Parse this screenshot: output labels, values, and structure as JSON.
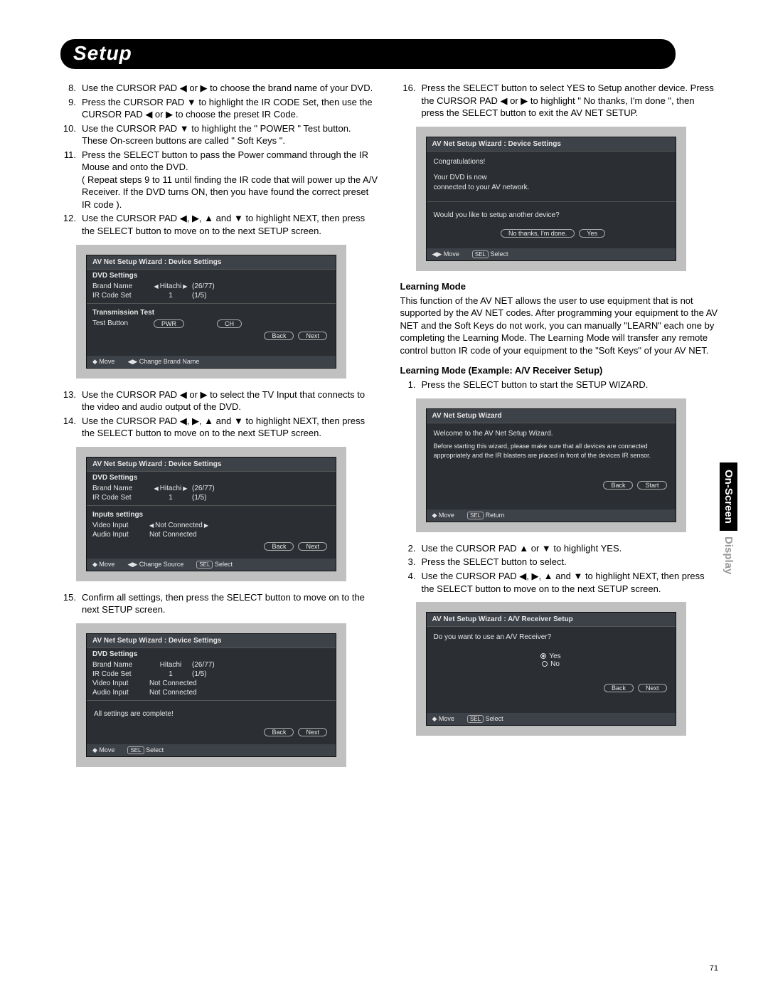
{
  "chapter": "Setup",
  "sideTab": {
    "black": "On-Screen",
    "gray": "Display"
  },
  "pageNumber": "71",
  "left": {
    "steps": [
      {
        "n": "8.",
        "t": "Use the CURSOR PAD ◀ or ▶ to choose the brand name of your DVD."
      },
      {
        "n": "9.",
        "t": "Press the CURSOR PAD ▼ to highlight the IR CODE Set, then use the CURSOR PAD ◀ or ▶ to choose the preset IR Code."
      },
      {
        "n": "10.",
        "t": "Use the CURSOR PAD ▼ to highlight the \" POWER \" Test button.\nThese On-screen buttons are called \" Soft Keys \"."
      },
      {
        "n": "11.",
        "t": "Press the SELECT button to pass the Power command through the IR Mouse and onto the DVD.\n( Repeat steps 9 to 11 until finding the IR code that will power up the A/V Receiver. If the DVD turns ON, then you have found the correct preset IR code )."
      },
      {
        "n": "12.",
        "t": "Use the CURSOR PAD ◀, ▶, ▲ and ▼ to highlight NEXT, then press the SELECT button to move on to the next SETUP screen."
      }
    ],
    "steps2": [
      {
        "n": "13.",
        "t": "Use the CURSOR PAD ◀ or ▶ to select the TV Input that connects to the video and audio output of the DVD."
      },
      {
        "n": "14.",
        "t": "Use the CURSOR PAD ◀, ▶, ▲ and ▼ to highlight NEXT, then press the SELECT button to move on to the next SETUP screen."
      }
    ],
    "steps3": [
      {
        "n": "15.",
        "t": "Confirm all settings, then  press the SELECT button to move on to the next SETUP screen."
      }
    ],
    "osd1": {
      "title": "AV Net Setup Wizard : Device Settings",
      "sub1": "DVD Settings",
      "brandLabel": "Brand Name",
      "brandVal": "Hitachi",
      "brandIdx": "(26/77)",
      "irLabel": "IR Code Set",
      "irVal": "1",
      "irIdx": "(1/5)",
      "sub2": "Transmission Test",
      "testLabel": "Test Button",
      "testBtn1": "PWR",
      "testBtn2": "CH",
      "btnBack": "Back",
      "btnNext": "Next",
      "foot1": "◆ Move",
      "foot2": "◀▶ Change Brand Name"
    },
    "osd2": {
      "title": "AV Net Setup Wizard : Device Settings",
      "sub1": "DVD Settings",
      "brandLabel": "Brand Name",
      "brandVal": "Hitachi",
      "brandIdx": "(26/77)",
      "irLabel": "IR Code Set",
      "irVal": "1",
      "irIdx": "(1/5)",
      "sub2": "Inputs settings",
      "videoLabel": "Video Input",
      "videoVal": "Not Connected",
      "audioLabel": "Audio Input",
      "audioVal": "Not Connected",
      "btnBack": "Back",
      "btnNext": "Next",
      "foot1": "◆ Move",
      "foot2": "◀▶ Change Source",
      "foot3Sel": "SEL",
      "foot3": "Select"
    },
    "osd3": {
      "title": "AV Net Setup Wizard : Device Settings",
      "sub1": "DVD Settings",
      "brandLabel": "Brand Name",
      "brandVal": "Hitachi",
      "brandIdx": "(26/77)",
      "irLabel": "IR Code Set",
      "irVal": "1",
      "irIdx": "(1/5)",
      "videoLabel": "Video Input",
      "videoVal": "Not Connected",
      "audioLabel": "Audio Input",
      "audioVal": "Not Connected",
      "complete": "All settings are complete!",
      "btnBack": "Back",
      "btnNext": "Next",
      "foot1": "◆ Move",
      "foot2Sel": "SEL",
      "foot2": "Select"
    }
  },
  "right": {
    "step16": {
      "n": "16.",
      "t": "Press the SELECT button to select YES to Setup another device.  Press the CURSOR PAD ◀ or ▶ to highlight \" No thanks, I'm done \", then press the SELECT button to exit the AV NET SETUP."
    },
    "osd4": {
      "title": "AV Net Setup Wizard : Device Settings",
      "l1": "Congratulations!",
      "l2": "Your DVD is now",
      "l3": "connected to your AV network.",
      "q": "Would you like to setup another device?",
      "btnNo": "No thanks, I'm done.",
      "btnYes": "Yes",
      "foot1": "◀▶ Move",
      "foot2Sel": "SEL",
      "foot2": "Select"
    },
    "h1": "Learning Mode",
    "p1": "This function of the AV NET allows the user to  use equipment that is not supported by the AV NET codes. After programming your equipment to the AV NET and the Soft Keys do not work, you can manually \"LEARN\" each one by completing the Learning Mode.  The Learning Mode will transfer any remote control button IR code of your equipment to the \"Soft Keys\" of your AV NET.",
    "h2": "Learning Mode (Example: A/V Receiver Setup)",
    "stepsA": [
      {
        "n": "1.",
        "t": "Press the SELECT button to start the SETUP WIZARD."
      }
    ],
    "osd5": {
      "title": "AV Net Setup Wizard",
      "l1": "Welcome to the AV Net Setup Wizard.",
      "l2": "Before starting this wizard, please make sure that all devices are connected appropriately and the IR blasters are placed in front of the devices IR sensor.",
      "btnBack": "Back",
      "btnStart": "Start",
      "foot1": "◆ Move",
      "foot2Sel": "SEL",
      "foot2": "Return"
    },
    "stepsB": [
      {
        "n": "2.",
        "t": "Use the CURSOR PAD ▲ or ▼ to highlight YES."
      },
      {
        "n": "3.",
        "t": "Press the SELECT button to select."
      },
      {
        "n": "4.",
        "t": "Use the CURSOR PAD ◀, ▶, ▲ and ▼ to highlight NEXT, then press the SELECT button to move on to the next SETUP screen."
      }
    ],
    "osd6": {
      "title": "AV Net Setup Wizard : A/V Receiver Setup",
      "q": "Do you want to use an A/V Receiver?",
      "optYes": "Yes",
      "optNo": "No",
      "btnBack": "Back",
      "btnNext": "Next",
      "foot1": "◆ Move",
      "foot2Sel": "SEL",
      "foot2": "Select"
    }
  }
}
